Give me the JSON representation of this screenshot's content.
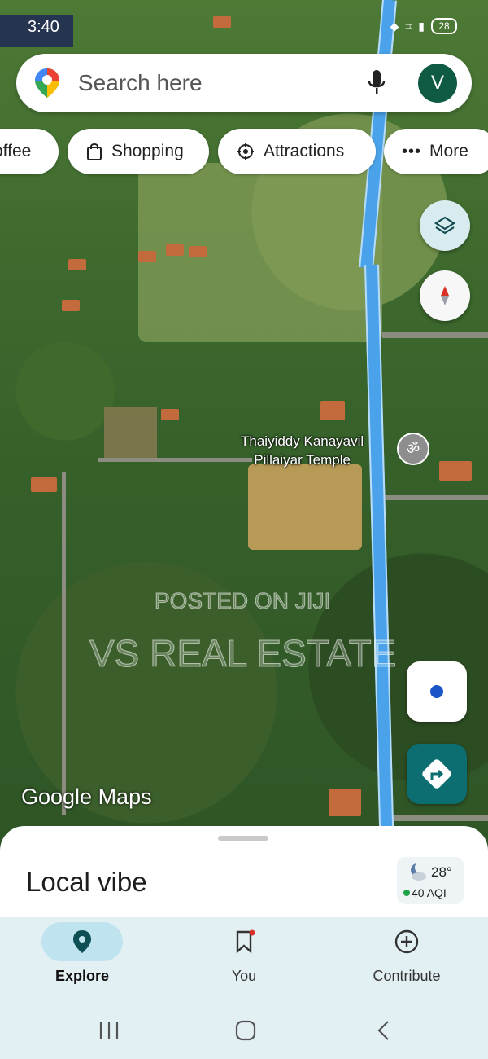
{
  "status_bar": {
    "time": "3:40",
    "battery": "28"
  },
  "search": {
    "placeholder": "Search here",
    "avatar_initial": "V"
  },
  "chips": [
    {
      "label": "offee",
      "icon": "coffee-icon"
    },
    {
      "label": "Shopping",
      "icon": "shopping-bag-icon"
    },
    {
      "label": "Attractions",
      "icon": "attractions-icon"
    },
    {
      "label": "More",
      "icon": "more-dots-icon"
    }
  ],
  "map": {
    "place_label_line1": "Thaiyiddy Kanayavil",
    "place_label_line2": "Pillaiyar Temple",
    "place_icon": "om-temple-icon",
    "logo": "Google Maps",
    "watermark_line1": "POSTED ON JIJI",
    "watermark_line2": "VS REAL ESTATE",
    "route_color": "#4aa3ea"
  },
  "sheet": {
    "title": "Local vibe",
    "weather_temp": "28°",
    "aqi": "40 AQI"
  },
  "bottom_nav": [
    {
      "label": "Explore",
      "icon": "explore-pin-icon",
      "active": true
    },
    {
      "label": "You",
      "icon": "bookmark-icon",
      "active": false
    },
    {
      "label": "Contribute",
      "icon": "add-circle-icon",
      "active": false
    }
  ],
  "colors": {
    "accent": "#0c6e70",
    "avatar": "#0f5a43",
    "nav_bg": "#e2f0f4"
  }
}
